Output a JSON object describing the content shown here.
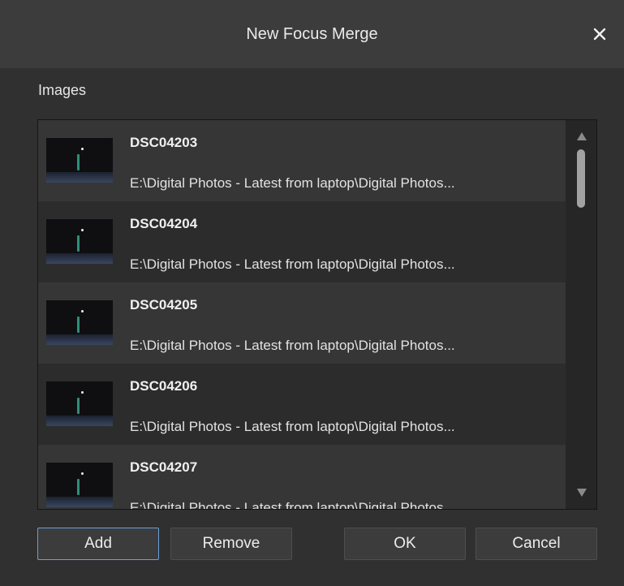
{
  "dialog": {
    "title": "New Focus Merge"
  },
  "images_section": {
    "label": "Images",
    "items": [
      {
        "name": "DSC04203",
        "path": "E:\\Digital Photos - Latest from laptop\\Digital Photos..."
      },
      {
        "name": "DSC04204",
        "path": "E:\\Digital Photos - Latest from laptop\\Digital Photos..."
      },
      {
        "name": "DSC04205",
        "path": "E:\\Digital Photos - Latest from laptop\\Digital Photos..."
      },
      {
        "name": "DSC04206",
        "path": "E:\\Digital Photos - Latest from laptop\\Digital Photos..."
      },
      {
        "name": "DSC04207",
        "path": "E:\\Digital Photos - Latest from laptop\\Digital Photos..."
      }
    ]
  },
  "buttons": {
    "add": "Add",
    "remove": "Remove",
    "ok": "OK",
    "cancel": "Cancel"
  },
  "icons": {
    "close": "close-icon",
    "scroll_up": "triangle-up-icon",
    "scroll_down": "triangle-down-icon"
  },
  "colors": {
    "background": "#303030",
    "title_bar": "#3c3c3c",
    "list_background": "#262626",
    "primary_button_border": "#6a9fd8"
  }
}
